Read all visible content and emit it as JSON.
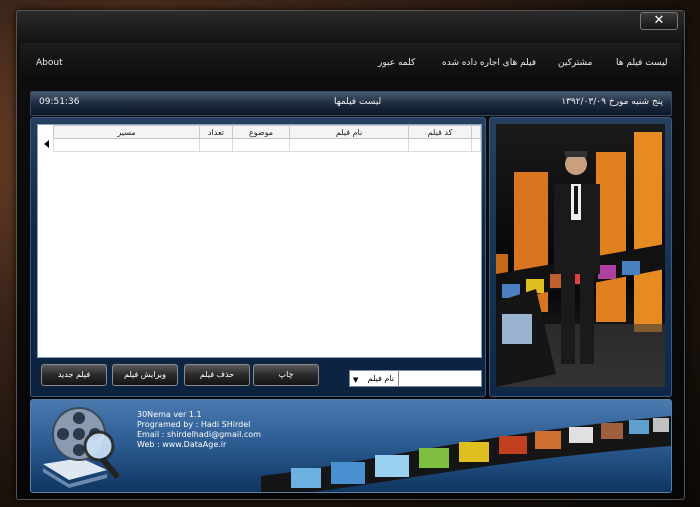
{
  "window": {
    "close_label": "✕"
  },
  "menu": {
    "about": "About",
    "password": "کلمه عبور",
    "rented_movies": "فیلم های اجاره داده شده",
    "customers": "مشترکین",
    "movie_list": "لیست فیلم ها"
  },
  "statusbar": {
    "time": "09:51:36",
    "title": "لیست فیلمها",
    "date": "پنج شنبه  مورخ ۱۳۹۲/۰۳/۰۹"
  },
  "grid": {
    "columns": [
      "مسیر",
      "تعداد",
      "موضوع",
      "نام فیلم",
      "کد فیلم"
    ]
  },
  "buttons": {
    "new_movie": "فیلم جدید",
    "edit_movie": "ویرایش فیلم",
    "delete_movie": "حذف فیلم",
    "print": "چاپ"
  },
  "search": {
    "field_selected": "نام فیلم",
    "value": ""
  },
  "credits": {
    "line1": "30Nema ver 1.1",
    "line2": "Programed by : Hadi SHirdel",
    "line3": "Email : shirdelhadi@gmail.com",
    "line4": "Web : www.DataAge.ir"
  },
  "colors": {
    "accent": "#1f3e66",
    "panel": "#2a5a90"
  }
}
